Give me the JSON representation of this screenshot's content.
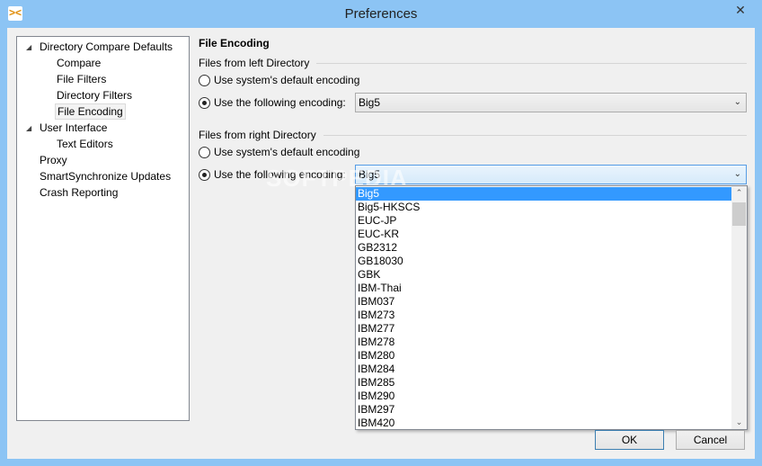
{
  "window": {
    "title": "Preferences",
    "close": "✕"
  },
  "tree": [
    {
      "label": "Directory Compare Defaults",
      "level": 0,
      "expanded": true
    },
    {
      "label": "Compare",
      "level": 1
    },
    {
      "label": "File Filters",
      "level": 1
    },
    {
      "label": "Directory Filters",
      "level": 1
    },
    {
      "label": "File Encoding",
      "level": 1,
      "selected": true
    },
    {
      "label": "User Interface",
      "level": 0,
      "expanded": true
    },
    {
      "label": "Text Editors",
      "level": 1
    },
    {
      "label": "Proxy",
      "level": 0
    },
    {
      "label": "SmartSynchronize Updates",
      "level": 0
    },
    {
      "label": "Crash Reporting",
      "level": 0
    }
  ],
  "section_title": "File Encoding",
  "left": {
    "group": "Files from left Directory",
    "default_label": "Use system's default encoding",
    "custom_label": "Use the following encoding:",
    "value": "Big5"
  },
  "right": {
    "group": "Files from right Directory",
    "default_label": "Use system's default encoding",
    "custom_label": "Use the following encoding:",
    "value": "Big5"
  },
  "dropdown_options": [
    "Big5",
    "Big5-HKSCS",
    "EUC-JP",
    "EUC-KR",
    "GB2312",
    "GB18030",
    "GBK",
    "IBM-Thai",
    "IBM037",
    "IBM273",
    "IBM277",
    "IBM278",
    "IBM280",
    "IBM284",
    "IBM285",
    "IBM290",
    "IBM297",
    "IBM420"
  ],
  "selected_option": "Big5",
  "buttons": {
    "ok": "OK",
    "cancel": "Cancel"
  },
  "watermark": "SOFTPEDIA"
}
